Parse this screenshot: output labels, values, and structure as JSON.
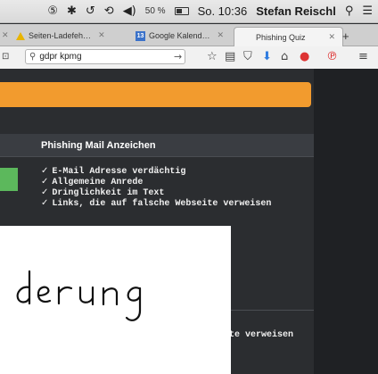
{
  "menubar": {
    "battery_percent": "50 %",
    "clock": "So. 10:36",
    "user": "Stefan Reischl",
    "icons": [
      "number5-icon",
      "bluetooth-icon",
      "timemachine-icon",
      "sync-icon",
      "volume-icon",
      "battery-icon",
      "spotlight-icon",
      "notification-list-icon"
    ]
  },
  "tabs": [
    {
      "label": "Seiten-Ladefeh…",
      "icon": "warning-icon"
    },
    {
      "label": "Google Kalend…",
      "icon": "calendar-icon",
      "icon_text": "13"
    },
    {
      "label": "Phishing Quiz",
      "active": true
    }
  ],
  "navbar": {
    "search_value": "gdpr kpmg"
  },
  "panel": {
    "title": "Phishing Mail Anzeichen",
    "items": [
      "E-Mail Adresse verdächtig",
      "Allgemeine Anrede",
      "Dringlichkeit im Text",
      "Links, die auf falsche Webseite verweisen"
    ]
  },
  "overlay": {
    "handwriting": "derung",
    "trailing_text": "te verweisen"
  },
  "colors": {
    "accent_orange": "#f29b2e",
    "green": "#5cb85c",
    "background": "#2b2d30"
  }
}
